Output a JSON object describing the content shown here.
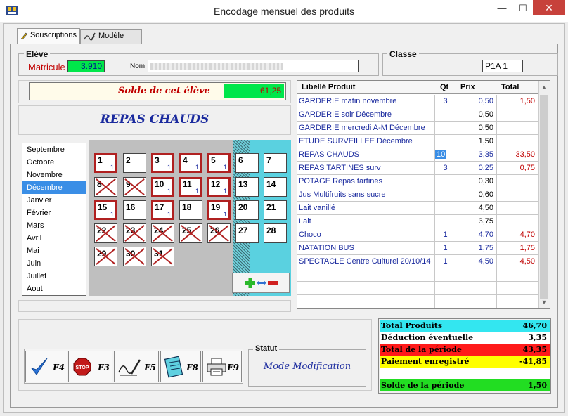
{
  "window": {
    "title": "Encodage mensuel des produits",
    "minimize": "—",
    "maximize": "☐",
    "close": "✕"
  },
  "tabs": [
    {
      "label": "Souscriptions"
    },
    {
      "label": "Modèle"
    }
  ],
  "eleve": {
    "group_label": "Elève",
    "matricule_label": "Matricule",
    "matricule": "3.910",
    "nom_label": "Nom"
  },
  "classe": {
    "group_label": "Classe",
    "value": "P1A 1"
  },
  "solde": {
    "label": "Solde de cet élève",
    "value": "61,25"
  },
  "repas_title": "REPAS CHAUDS",
  "months": [
    "Septembre",
    "Octobre",
    "Novembre",
    "Décembre",
    "Janvier",
    "Février",
    "Mars",
    "Avril",
    "Mai",
    "Juin",
    "Juillet",
    "Aout"
  ],
  "selected_month": "Décembre",
  "calendar": {
    "days": [
      {
        "d": "1",
        "q": "1",
        "marked": true,
        "cross": false
      },
      {
        "d": "2",
        "q": "",
        "marked": false,
        "cross": false
      },
      {
        "d": "3",
        "q": "1",
        "marked": true,
        "cross": false
      },
      {
        "d": "4",
        "q": "1",
        "marked": true,
        "cross": false
      },
      {
        "d": "5",
        "q": "1",
        "marked": true,
        "cross": false
      },
      {
        "d": "6",
        "q": "",
        "marked": false,
        "cross": false
      },
      {
        "d": "7",
        "q": "",
        "marked": false,
        "cross": false
      },
      {
        "d": "8",
        "q": "",
        "marked": false,
        "cross": true
      },
      {
        "d": "9",
        "q": "",
        "marked": false,
        "cross": true
      },
      {
        "d": "10",
        "q": "1",
        "marked": true,
        "cross": false
      },
      {
        "d": "11",
        "q": "1",
        "marked": true,
        "cross": false
      },
      {
        "d": "12",
        "q": "1",
        "marked": true,
        "cross": false
      },
      {
        "d": "13",
        "q": "",
        "marked": false,
        "cross": false
      },
      {
        "d": "14",
        "q": "",
        "marked": false,
        "cross": false
      },
      {
        "d": "15",
        "q": "1",
        "marked": true,
        "cross": false
      },
      {
        "d": "16",
        "q": "",
        "marked": false,
        "cross": false
      },
      {
        "d": "17",
        "q": "1",
        "marked": true,
        "cross": false
      },
      {
        "d": "18",
        "q": "",
        "marked": false,
        "cross": false
      },
      {
        "d": "19",
        "q": "1",
        "marked": true,
        "cross": false
      },
      {
        "d": "20",
        "q": "",
        "marked": false,
        "cross": false
      },
      {
        "d": "21",
        "q": "",
        "marked": false,
        "cross": false
      },
      {
        "d": "22",
        "q": "",
        "marked": false,
        "cross": true
      },
      {
        "d": "23",
        "q": "",
        "marked": false,
        "cross": true
      },
      {
        "d": "24",
        "q": "",
        "marked": false,
        "cross": true
      },
      {
        "d": "25",
        "q": "",
        "marked": false,
        "cross": true
      },
      {
        "d": "26",
        "q": "",
        "marked": false,
        "cross": true
      },
      {
        "d": "27",
        "q": "",
        "marked": false,
        "cross": false
      },
      {
        "d": "28",
        "q": "",
        "marked": false,
        "cross": false
      },
      {
        "d": "29",
        "q": "",
        "marked": false,
        "cross": true
      },
      {
        "d": "30",
        "q": "",
        "marked": false,
        "cross": true
      },
      {
        "d": "31",
        "q": "",
        "marked": false,
        "cross": true
      }
    ]
  },
  "grid": {
    "headers": {
      "libelle": "Libellé Produit",
      "qt": "Qt",
      "prix": "Prix",
      "total": "Total"
    },
    "rows": [
      {
        "libelle": "GARDERIE matin novembre",
        "qt": "3",
        "prix": "0,50",
        "total": "1,50"
      },
      {
        "libelle": "GARDERIE soir Décembre",
        "qt": "",
        "prix": "0,50",
        "total": ""
      },
      {
        "libelle": "GARDERIE mercredi A-M Décembre",
        "qt": "",
        "prix": "0,50",
        "total": ""
      },
      {
        "libelle": "ETUDE SURVEILLEE Décembre",
        "qt": "",
        "prix": "1,50",
        "total": ""
      },
      {
        "libelle": "REPAS CHAUDS",
        "qt": "10",
        "prix": "3,35",
        "total": "33,50"
      },
      {
        "libelle": "REPAS TARTINES surv",
        "qt": "3",
        "prix": "0,25",
        "total": "0,75"
      },
      {
        "libelle": "POTAGE  Repas tartines",
        "qt": "",
        "prix": "0,30",
        "total": ""
      },
      {
        "libelle": "Jus Multifruits sans sucre",
        "qt": "",
        "prix": "0,60",
        "total": ""
      },
      {
        "libelle": "Lait vanillé",
        "qt": "",
        "prix": "4,50",
        "total": ""
      },
      {
        "libelle": "Lait",
        "qt": "",
        "prix": "3,75",
        "total": ""
      },
      {
        "libelle": "Choco",
        "qt": "1",
        "prix": "4,70",
        "total": "4,70"
      },
      {
        "libelle": "NATATION BUS",
        "qt": "1",
        "prix": "1,75",
        "total": "1,75"
      },
      {
        "libelle": "SPECTACLE Centre Culturel 20/10/14",
        "qt": "1",
        "prix": "4,50",
        "total": "4,50"
      },
      {
        "libelle": "",
        "qt": "",
        "prix": "",
        "total": ""
      },
      {
        "libelle": "",
        "qt": "",
        "prix": "",
        "total": ""
      },
      {
        "libelle": "",
        "qt": "",
        "prix": "",
        "total": ""
      }
    ]
  },
  "fkeys": [
    {
      "key": "F4",
      "icon": "checkmark-icon"
    },
    {
      "key": "F3",
      "icon": "stop-icon"
    },
    {
      "key": "F5",
      "icon": "signature-icon"
    },
    {
      "key": "F8",
      "icon": "notepad-icon"
    },
    {
      "key": "F9",
      "icon": "printer-icon"
    }
  ],
  "statut": {
    "label": "Statut",
    "value": "Mode Modification"
  },
  "totals": [
    {
      "label": "Total Produits",
      "value": "46,70",
      "bg": "#33e6f0"
    },
    {
      "label": "Déduction éventuelle",
      "value": "3,35",
      "bg": "#ffffff"
    },
    {
      "label": "Total de la période",
      "value": "43,35",
      "bg": "#ff1a1a"
    },
    {
      "label": "Paiement enregistré",
      "value": "-41,85",
      "bg": "#ffff00"
    },
    {
      "label": "",
      "value": "",
      "bg": "#ffffff"
    },
    {
      "label": "Solde de la période",
      "value": "1,50",
      "bg": "#22dd22"
    }
  ],
  "colors": {
    "accent_blue": "#1a2a9e",
    "accent_red": "#c00000",
    "selection": "#3a8ee6",
    "solde_green": "#00e64a"
  }
}
